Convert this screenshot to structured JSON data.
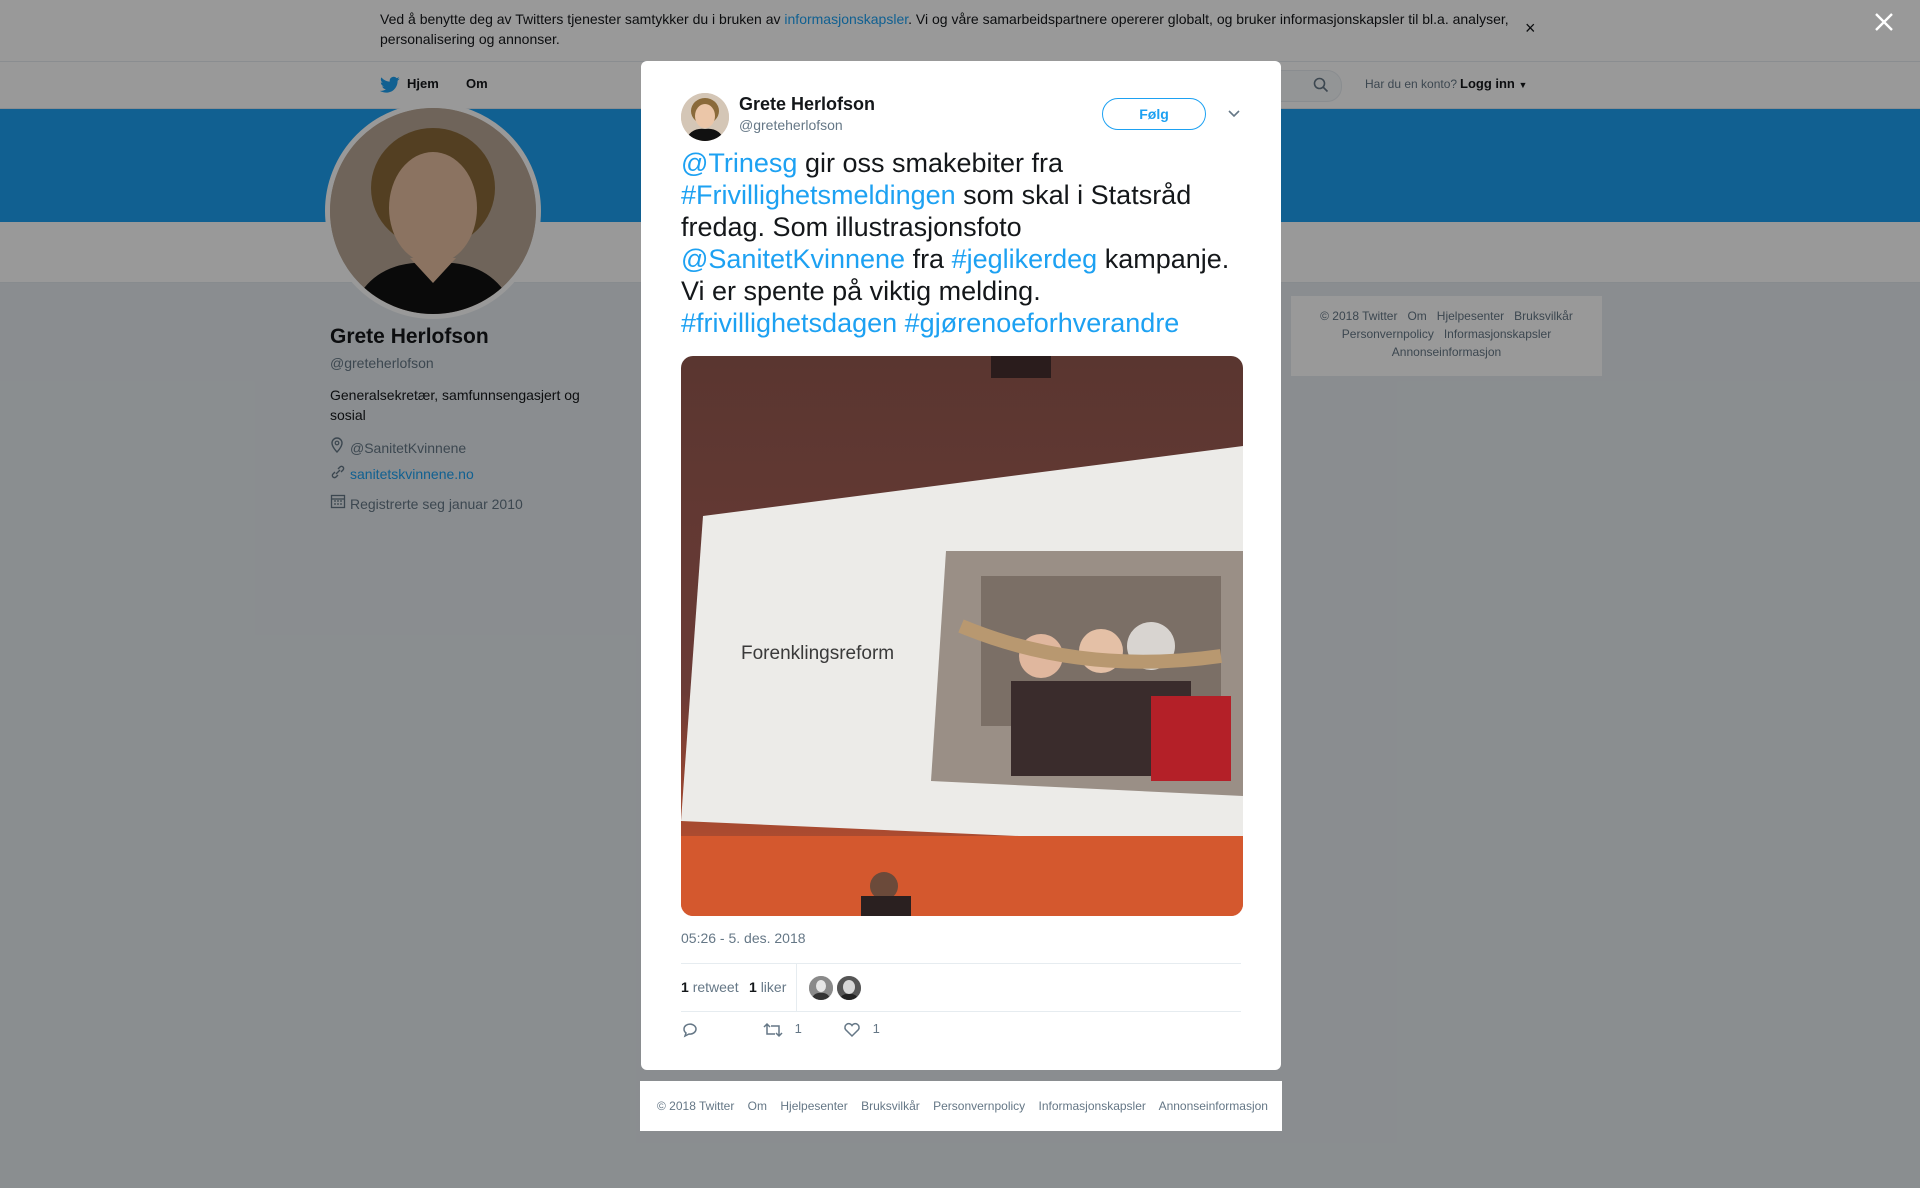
{
  "cookie": {
    "text_before": "Ved å benytte deg av Twitters tjenester samtykker du i bruken av ",
    "link": "informasjonskapsler",
    "text_after": ". Vi og våre samarbeidspartnere opererer globalt, og bruker informasjonskapsler til bl.a. analyser, personalisering og annonser.",
    "close": "×"
  },
  "nav": {
    "home": "Hjem",
    "about": "Om",
    "login_question": "Har du en konto?",
    "login": "Logg inn"
  },
  "profile": {
    "name": "Grete Herlofson",
    "handle": "@greteherlofson",
    "bio": "Generalsekretær, samfunnsengasjert og sosial",
    "location": "@SanitetKvinnene",
    "website": "sanitetskvinnene.no",
    "joined": "Registrerte seg januar 2010"
  },
  "side_footer": {
    "items": [
      "© 2018 Twitter",
      "Om",
      "Hjelpesenter",
      "Bruksvilkår",
      "Personvernpolicy",
      "Informasjonskapsler",
      "Annonseinformasjon"
    ]
  },
  "close_overlay": "×",
  "tweet": {
    "author_name": "Grete Herlofson",
    "author_handle": "@greteherlofson",
    "follow": "Følg",
    "parts": [
      {
        "t": "@Trinesg",
        "link": true
      },
      {
        "t": " gir oss smakebiter fra ",
        "link": false
      },
      {
        "t": "#Frivillighetsmeldingen",
        "link": true
      },
      {
        "t": " som skal i Statsråd fredag. Som illustrasjonsfoto ",
        "link": false
      },
      {
        "t": "@SanitetKvinnene",
        "link": true
      },
      {
        "t": " fra ",
        "link": false
      },
      {
        "t": "#jeglikerdeg",
        "link": true
      },
      {
        "t": " kampanje. Vi er spente på viktig melding. ",
        "link": false
      },
      {
        "t": "#frivillighetsdagen",
        "link": true
      },
      {
        "t": " ",
        "link": false
      },
      {
        "t": "#gjørenoeforhverandre",
        "link": true
      }
    ],
    "media_caption": "Forenklingsreform",
    "timestamp": "05:26 - 5. des. 2018",
    "retweet_count": "1",
    "retweet_label": "retweet",
    "like_count": "1",
    "like_label": "liker",
    "action_retweet_count": "1",
    "action_like_count": "1"
  },
  "modal_footer": {
    "items": [
      "© 2018 Twitter",
      "Om",
      "Hjelpesenter",
      "Bruksvilkår",
      "Personvernpolicy",
      "Informasjonskapsler",
      "Annonseinformasjon"
    ]
  },
  "colors": {
    "accent": "#1da1f2",
    "muted": "#657786",
    "text": "#14171a"
  }
}
